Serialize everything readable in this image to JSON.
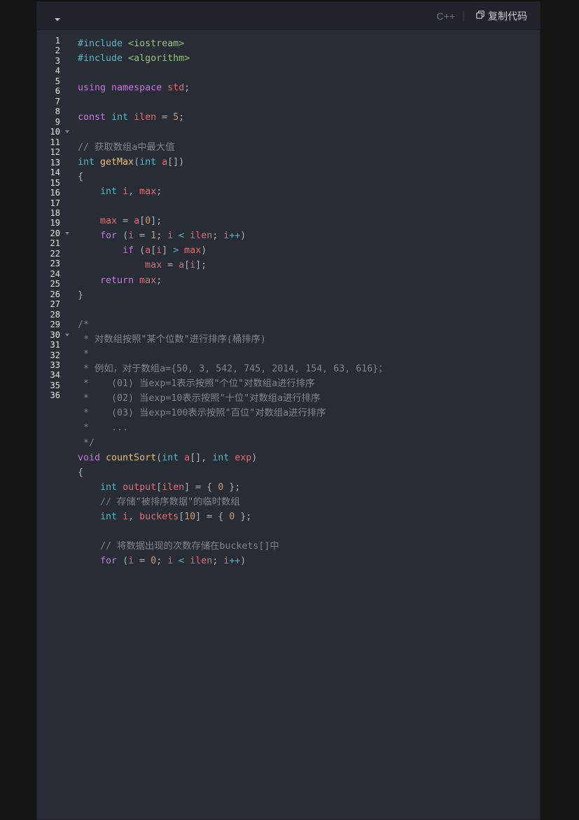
{
  "header": {
    "language": "C++",
    "copy_label": "复制代码"
  },
  "gutter": {
    "line_numbers": [
      "1",
      "2",
      "3",
      "4",
      "5",
      "6",
      "7",
      "8",
      "9",
      "10",
      "11",
      "12",
      "13",
      "14",
      "15",
      "16",
      "17",
      "18",
      "19",
      "20",
      "21",
      "22",
      "23",
      "24",
      "25",
      "26",
      "27",
      "28",
      "29",
      "30",
      "31",
      "32",
      "33",
      "34",
      "35",
      "36"
    ],
    "fold_lines": [
      "10",
      "20",
      "30"
    ]
  },
  "code": {
    "lines": [
      [
        [
          "#include ",
          "pp"
        ],
        [
          "<iostream>",
          "str"
        ]
      ],
      [
        [
          "#include ",
          "pp"
        ],
        [
          "<algorithm>",
          "str"
        ]
      ],
      [],
      [
        [
          "using ",
          "kw"
        ],
        [
          "namespace ",
          "kw"
        ],
        [
          "std",
          "var"
        ],
        [
          ";",
          "plain"
        ]
      ],
      [],
      [
        [
          "const ",
          "kw"
        ],
        [
          "int ",
          "type"
        ],
        [
          "ilen ",
          "var"
        ],
        [
          "= ",
          "plain"
        ],
        [
          "5",
          "num"
        ],
        [
          ";",
          "plain"
        ]
      ],
      [],
      [
        [
          "// 获取数组a中最大值",
          "cm"
        ]
      ],
      [
        [
          "int ",
          "type"
        ],
        [
          "getMax",
          "fn"
        ],
        [
          "(",
          "plain"
        ],
        [
          "int ",
          "type"
        ],
        [
          "a",
          "var"
        ],
        [
          "[])",
          "plain"
        ]
      ],
      [
        [
          "{",
          "plain"
        ]
      ],
      [
        [
          "    ",
          "plain"
        ],
        [
          "int ",
          "type"
        ],
        [
          "i",
          "var"
        ],
        [
          ", ",
          "plain"
        ],
        [
          "max",
          "var"
        ],
        [
          ";",
          "plain"
        ]
      ],
      [],
      [
        [
          "    ",
          "plain"
        ],
        [
          "max ",
          "var"
        ],
        [
          "= ",
          "plain"
        ],
        [
          "a",
          "var"
        ],
        [
          "[",
          "plain"
        ],
        [
          "0",
          "num"
        ],
        [
          "];",
          "plain"
        ]
      ],
      [
        [
          "    ",
          "plain"
        ],
        [
          "for ",
          "kw"
        ],
        [
          "(",
          "plain"
        ],
        [
          "i ",
          "var"
        ],
        [
          "= ",
          "plain"
        ],
        [
          "1",
          "num"
        ],
        [
          "; ",
          "plain"
        ],
        [
          "i ",
          "var"
        ],
        [
          "< ",
          "op"
        ],
        [
          "ilen",
          "var"
        ],
        [
          "; ",
          "plain"
        ],
        [
          "i",
          "var"
        ],
        [
          "++",
          "op"
        ],
        [
          ")",
          "plain"
        ]
      ],
      [
        [
          "        ",
          "plain"
        ],
        [
          "if ",
          "kw"
        ],
        [
          "(",
          "plain"
        ],
        [
          "a",
          "var"
        ],
        [
          "[",
          "plain"
        ],
        [
          "i",
          "var"
        ],
        [
          "] ",
          "plain"
        ],
        [
          "> ",
          "op"
        ],
        [
          "max",
          "var"
        ],
        [
          ")",
          "plain"
        ]
      ],
      [
        [
          "            ",
          "plain"
        ],
        [
          "max ",
          "var"
        ],
        [
          "= ",
          "plain"
        ],
        [
          "a",
          "var"
        ],
        [
          "[",
          "plain"
        ],
        [
          "i",
          "var"
        ],
        [
          "];",
          "plain"
        ]
      ],
      [
        [
          "    ",
          "plain"
        ],
        [
          "return ",
          "kw"
        ],
        [
          "max",
          "var"
        ],
        [
          ";",
          "plain"
        ]
      ],
      [
        [
          "}",
          "plain"
        ]
      ],
      [],
      [
        [
          "/*",
          "cm"
        ]
      ],
      [
        [
          " * 对数组按照\"某个位数\"进行排序(桶排序)",
          "cm"
        ]
      ],
      [
        [
          " *",
          "cm"
        ]
      ],
      [
        [
          " * 例如，对于数组a={50, 3, 542, 745, 2014, 154, 63, 616}；",
          "cm"
        ]
      ],
      [
        [
          " *    (01) 当exp=1表示按照\"个位\"对数组a进行排序",
          "cm"
        ]
      ],
      [
        [
          " *    (02) 当exp=10表示按照\"十位\"对数组a进行排序",
          "cm"
        ]
      ],
      [
        [
          " *    (03) 当exp=100表示按照\"百位\"对数组a进行排序",
          "cm"
        ]
      ],
      [
        [
          " *    ...",
          "cm"
        ]
      ],
      [
        [
          " */",
          "cm"
        ]
      ],
      [
        [
          "void ",
          "kw"
        ],
        [
          "countSort",
          "fn"
        ],
        [
          "(",
          "plain"
        ],
        [
          "int ",
          "type"
        ],
        [
          "a",
          "var"
        ],
        [
          "[], ",
          "plain"
        ],
        [
          "int ",
          "type"
        ],
        [
          "exp",
          "var"
        ],
        [
          ")",
          "plain"
        ]
      ],
      [
        [
          "{",
          "plain"
        ]
      ],
      [
        [
          "    ",
          "plain"
        ],
        [
          "int ",
          "type"
        ],
        [
          "output",
          "var"
        ],
        [
          "[",
          "plain"
        ],
        [
          "ilen",
          "var"
        ],
        [
          "] = { ",
          "plain"
        ],
        [
          "0",
          "num"
        ],
        [
          " };",
          "plain"
        ]
      ],
      [
        [
          "    ",
          "plain"
        ],
        [
          "// 存储\"被排序数据\"的临时数组",
          "cm"
        ]
      ],
      [
        [
          "    ",
          "plain"
        ],
        [
          "int ",
          "type"
        ],
        [
          "i",
          "var"
        ],
        [
          ", ",
          "plain"
        ],
        [
          "buckets",
          "var"
        ],
        [
          "[",
          "plain"
        ],
        [
          "10",
          "num"
        ],
        [
          "] = { ",
          "plain"
        ],
        [
          "0",
          "num"
        ],
        [
          " };",
          "plain"
        ]
      ],
      [],
      [
        [
          "    ",
          "plain"
        ],
        [
          "// 将数据出现的次数存储在buckets[]中",
          "cm"
        ]
      ],
      [
        [
          "    ",
          "plain"
        ],
        [
          "for ",
          "kw"
        ],
        [
          "(",
          "plain"
        ],
        [
          "i ",
          "var"
        ],
        [
          "= ",
          "plain"
        ],
        [
          "0",
          "num"
        ],
        [
          "; ",
          "plain"
        ],
        [
          "i ",
          "var"
        ],
        [
          "< ",
          "op"
        ],
        [
          "ilen",
          "var"
        ],
        [
          "; ",
          "plain"
        ],
        [
          "i",
          "var"
        ],
        [
          "++",
          "op"
        ],
        [
          ")",
          "plain"
        ]
      ]
    ]
  }
}
